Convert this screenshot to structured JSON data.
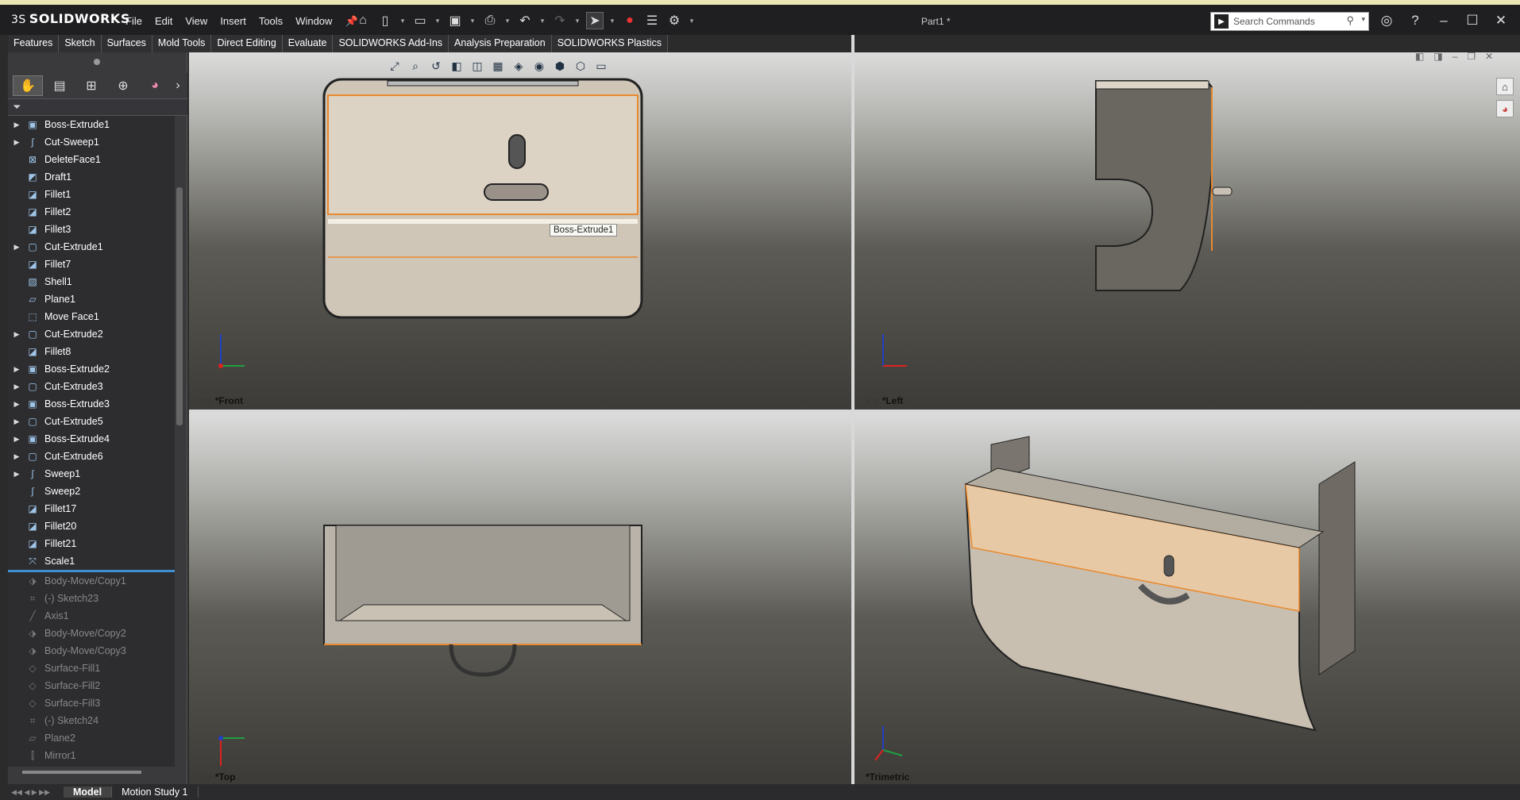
{
  "app": {
    "name": "SOLIDWORKS",
    "logo_prefix": "3S",
    "document_title": "Part1 *"
  },
  "menu": [
    "File",
    "Edit",
    "View",
    "Insert",
    "Tools",
    "Window"
  ],
  "pin_icon": "pin-icon",
  "search": {
    "placeholder": "Search Commands"
  },
  "command_tabs": [
    "Features",
    "Sketch",
    "Surfaces",
    "Mold Tools",
    "Direct Editing",
    "Evaluate",
    "SOLIDWORKS Add-Ins",
    "Analysis Preparation",
    "SOLIDWORKS Plastics"
  ],
  "feature_tree": {
    "active": [
      {
        "label": "Boss-Extrude1",
        "icon": "extrude-icon",
        "expandable": true
      },
      {
        "label": "Cut-Sweep1",
        "icon": "sweep-icon",
        "expandable": true
      },
      {
        "label": "DeleteFace1",
        "icon": "delete-face-icon",
        "expandable": false
      },
      {
        "label": "Draft1",
        "icon": "draft-icon",
        "expandable": false
      },
      {
        "label": "Fillet1",
        "icon": "fillet-icon",
        "expandable": false
      },
      {
        "label": "Fillet2",
        "icon": "fillet-icon",
        "expandable": false
      },
      {
        "label": "Fillet3",
        "icon": "fillet-icon",
        "expandable": false
      },
      {
        "label": "Cut-Extrude1",
        "icon": "cut-extrude-icon",
        "expandable": true
      },
      {
        "label": "Fillet7",
        "icon": "fillet-icon",
        "expandable": false
      },
      {
        "label": "Shell1",
        "icon": "shell-icon",
        "expandable": false
      },
      {
        "label": "Plane1",
        "icon": "plane-icon",
        "expandable": false
      },
      {
        "label": "Move Face1",
        "icon": "move-face-icon",
        "expandable": false
      },
      {
        "label": "Cut-Extrude2",
        "icon": "cut-extrude-icon",
        "expandable": true
      },
      {
        "label": "Fillet8",
        "icon": "fillet-icon",
        "expandable": false
      },
      {
        "label": "Boss-Extrude2",
        "icon": "extrude-icon",
        "expandable": true
      },
      {
        "label": "Cut-Extrude3",
        "icon": "cut-extrude-icon",
        "expandable": true
      },
      {
        "label": "Boss-Extrude3",
        "icon": "extrude-icon",
        "expandable": true
      },
      {
        "label": "Cut-Extrude5",
        "icon": "cut-extrude-icon",
        "expandable": true
      },
      {
        "label": "Boss-Extrude4",
        "icon": "extrude-icon",
        "expandable": true
      },
      {
        "label": "Cut-Extrude6",
        "icon": "cut-extrude-icon",
        "expandable": true
      },
      {
        "label": "Sweep1",
        "icon": "sweep-icon",
        "expandable": true
      },
      {
        "label": "Sweep2",
        "icon": "sweep-icon",
        "expandable": false
      },
      {
        "label": "Fillet17",
        "icon": "fillet-icon",
        "expandable": false
      },
      {
        "label": "Fillet20",
        "icon": "fillet-icon",
        "expandable": false
      },
      {
        "label": "Fillet21",
        "icon": "fillet-icon",
        "expandable": false
      },
      {
        "label": "Scale1",
        "icon": "scale-icon",
        "expandable": false
      }
    ],
    "suppressed": [
      {
        "label": "Body-Move/Copy1",
        "icon": "move-body-icon"
      },
      {
        "label": "(-) Sketch23",
        "icon": "sketch-icon"
      },
      {
        "label": "Axis1",
        "icon": "axis-icon"
      },
      {
        "label": "Body-Move/Copy2",
        "icon": "move-body-icon"
      },
      {
        "label": "Body-Move/Copy3",
        "icon": "move-body-icon"
      },
      {
        "label": "Surface-Fill1",
        "icon": "surface-fill-icon"
      },
      {
        "label": "Surface-Fill2",
        "icon": "surface-fill-icon"
      },
      {
        "label": "Surface-Fill3",
        "icon": "surface-fill-icon"
      },
      {
        "label": "(-) Sketch24",
        "icon": "sketch-icon"
      },
      {
        "label": "Plane2",
        "icon": "plane-icon"
      },
      {
        "label": "Mirror1",
        "icon": "mirror-icon"
      }
    ]
  },
  "viewports": [
    {
      "name": "*Front"
    },
    {
      "name": "*Left"
    },
    {
      "name": "*Top"
    },
    {
      "name": "*Trimetric"
    }
  ],
  "tooltip": "Boss-Extrude1",
  "bottom_tabs": [
    "Model",
    "Motion Study 1"
  ],
  "colors": {
    "accent": "#3f8fd0",
    "selection": "#e9892e",
    "model": "#c9bfb0",
    "model_highlight": "#e8c9a5"
  }
}
